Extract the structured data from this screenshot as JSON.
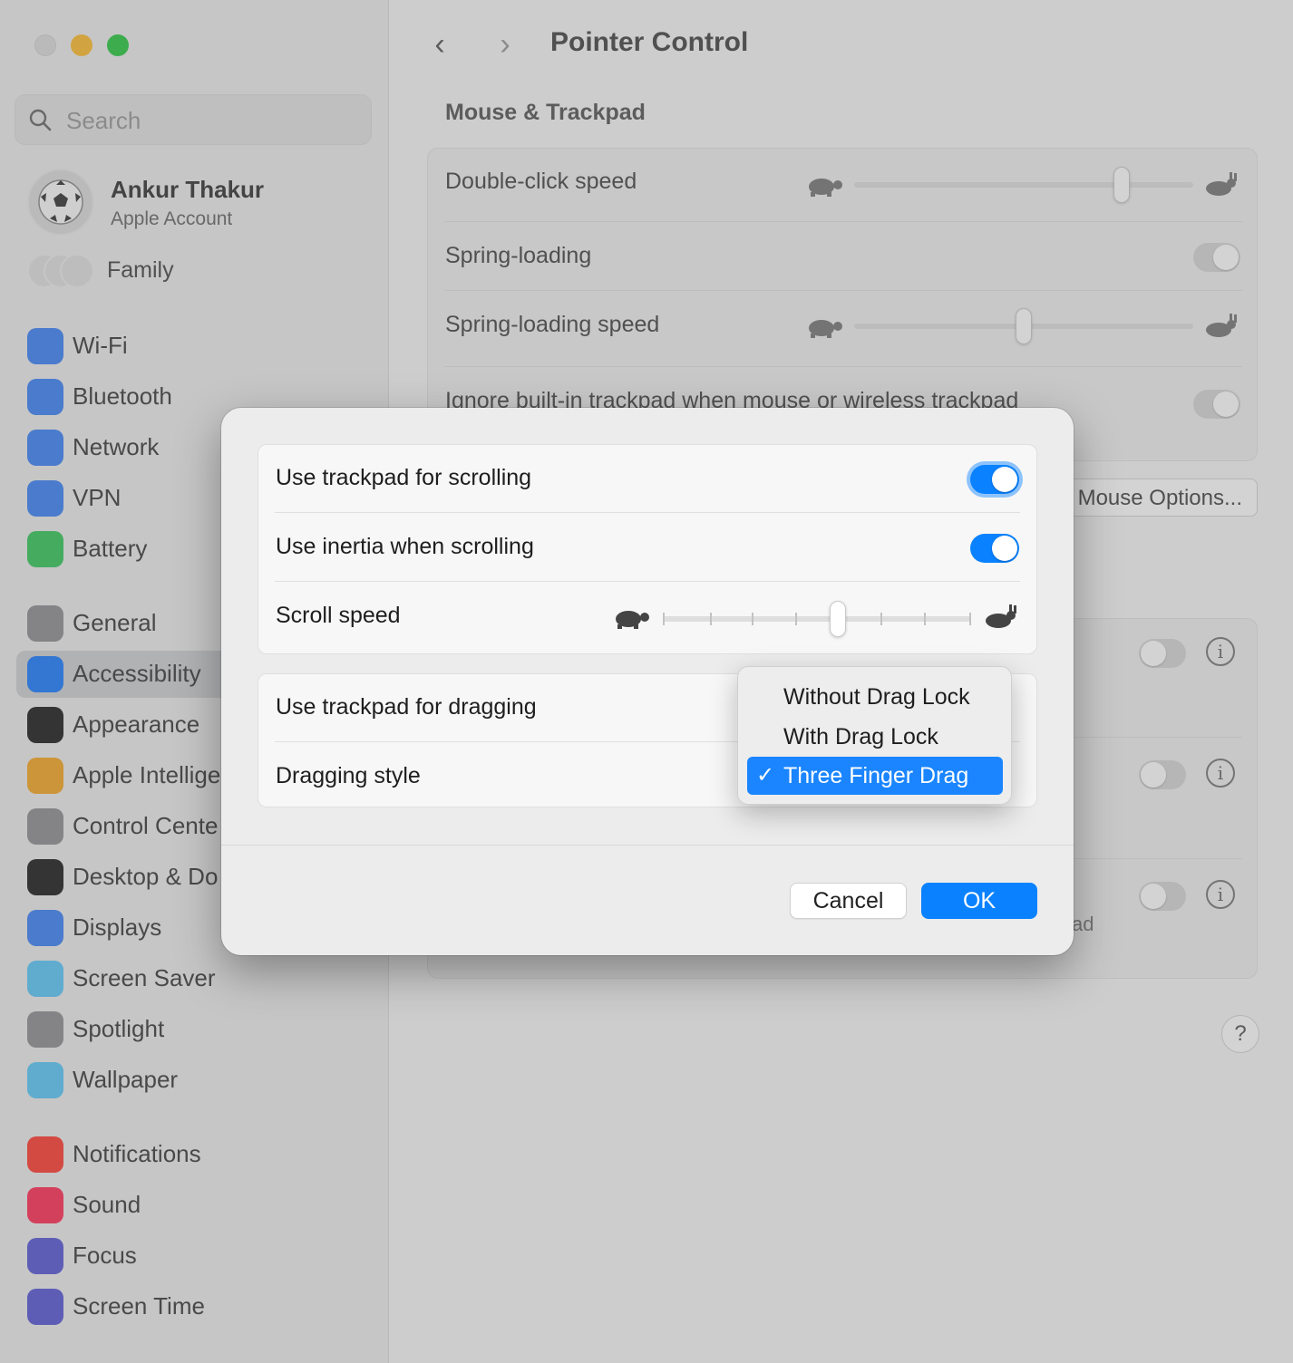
{
  "window": {
    "controls": [
      "close",
      "minimize",
      "maximize"
    ]
  },
  "sidebar": {
    "search_placeholder": "Search",
    "account": {
      "name": "Ankur Thakur",
      "subtitle": "Apple Account"
    },
    "family_label": "Family",
    "items": [
      {
        "label": "Wi-Fi",
        "icon": "wifi-icon",
        "color": "#3b82f6"
      },
      {
        "label": "Bluetooth",
        "icon": "bluetooth-icon",
        "color": "#3b82f6"
      },
      {
        "label": "Network",
        "icon": "globe-icon",
        "color": "#3b82f6"
      },
      {
        "label": "VPN",
        "icon": "vpn-globe-icon",
        "color": "#3b82f6"
      },
      {
        "label": "Battery",
        "icon": "battery-icon",
        "color": "#34c759"
      },
      {
        "label": "General",
        "icon": "gear-icon",
        "color": "#8e8e93"
      },
      {
        "label": "Accessibility",
        "icon": "accessibility-icon",
        "color": "#1a7bff",
        "selected": true
      },
      {
        "label": "Appearance",
        "icon": "appearance-icon",
        "color": "#1c1c1e"
      },
      {
        "label": "Apple Intellige",
        "icon": "apple-intelligence-icon",
        "color": "#f5a623"
      },
      {
        "label": "Control Cente",
        "icon": "control-center-icon",
        "color": "#8e8e93"
      },
      {
        "label": "Desktop & Do",
        "icon": "desktop-dock-icon",
        "color": "#1c1c1e"
      },
      {
        "label": "Displays",
        "icon": "displays-icon",
        "color": "#3b82f6"
      },
      {
        "label": "Screen Saver",
        "icon": "screen-saver-icon",
        "color": "#5ac8fa"
      },
      {
        "label": "Spotlight",
        "icon": "spotlight-icon",
        "color": "#8e8e93"
      },
      {
        "label": "Wallpaper",
        "icon": "wallpaper-icon",
        "color": "#5ac8fa"
      },
      {
        "label": "Notifications",
        "icon": "notifications-icon",
        "color": "#ff3b30"
      },
      {
        "label": "Sound",
        "icon": "sound-icon",
        "color": "#ff2d55"
      },
      {
        "label": "Focus",
        "icon": "focus-moon-icon",
        "color": "#5856d6"
      },
      {
        "label": "Screen Time",
        "icon": "hourglass-icon",
        "color": "#5856d6"
      }
    ]
  },
  "main": {
    "title": "Pointer Control",
    "section_title": "Mouse & Trackpad",
    "rows": {
      "double_click": "Double-click speed",
      "spring_loading": "Spring-loading",
      "spring_loading_speed": "Spring-loading speed",
      "ignore_trackpad": "Ignore built-in trackpad when mouse or wireless trackpad"
    },
    "mouse_options_button": "Mouse Options...",
    "partial_text": "ad",
    "help_button": "?"
  },
  "sheet": {
    "use_trackpad_scrolling": "Use trackpad for scrolling",
    "use_inertia": "Use inertia when scrolling",
    "scroll_speed": "Scroll speed",
    "use_trackpad_dragging": "Use trackpad for dragging",
    "dragging_style": "Dragging style",
    "cancel": "Cancel",
    "ok": "OK",
    "accent_color": "#0a82ff"
  },
  "dragging_menu": {
    "options": [
      "Without Drag Lock",
      "With Drag Lock",
      "Three Finger Drag"
    ],
    "selected": "Three Finger Drag",
    "checkmark": "✓"
  }
}
